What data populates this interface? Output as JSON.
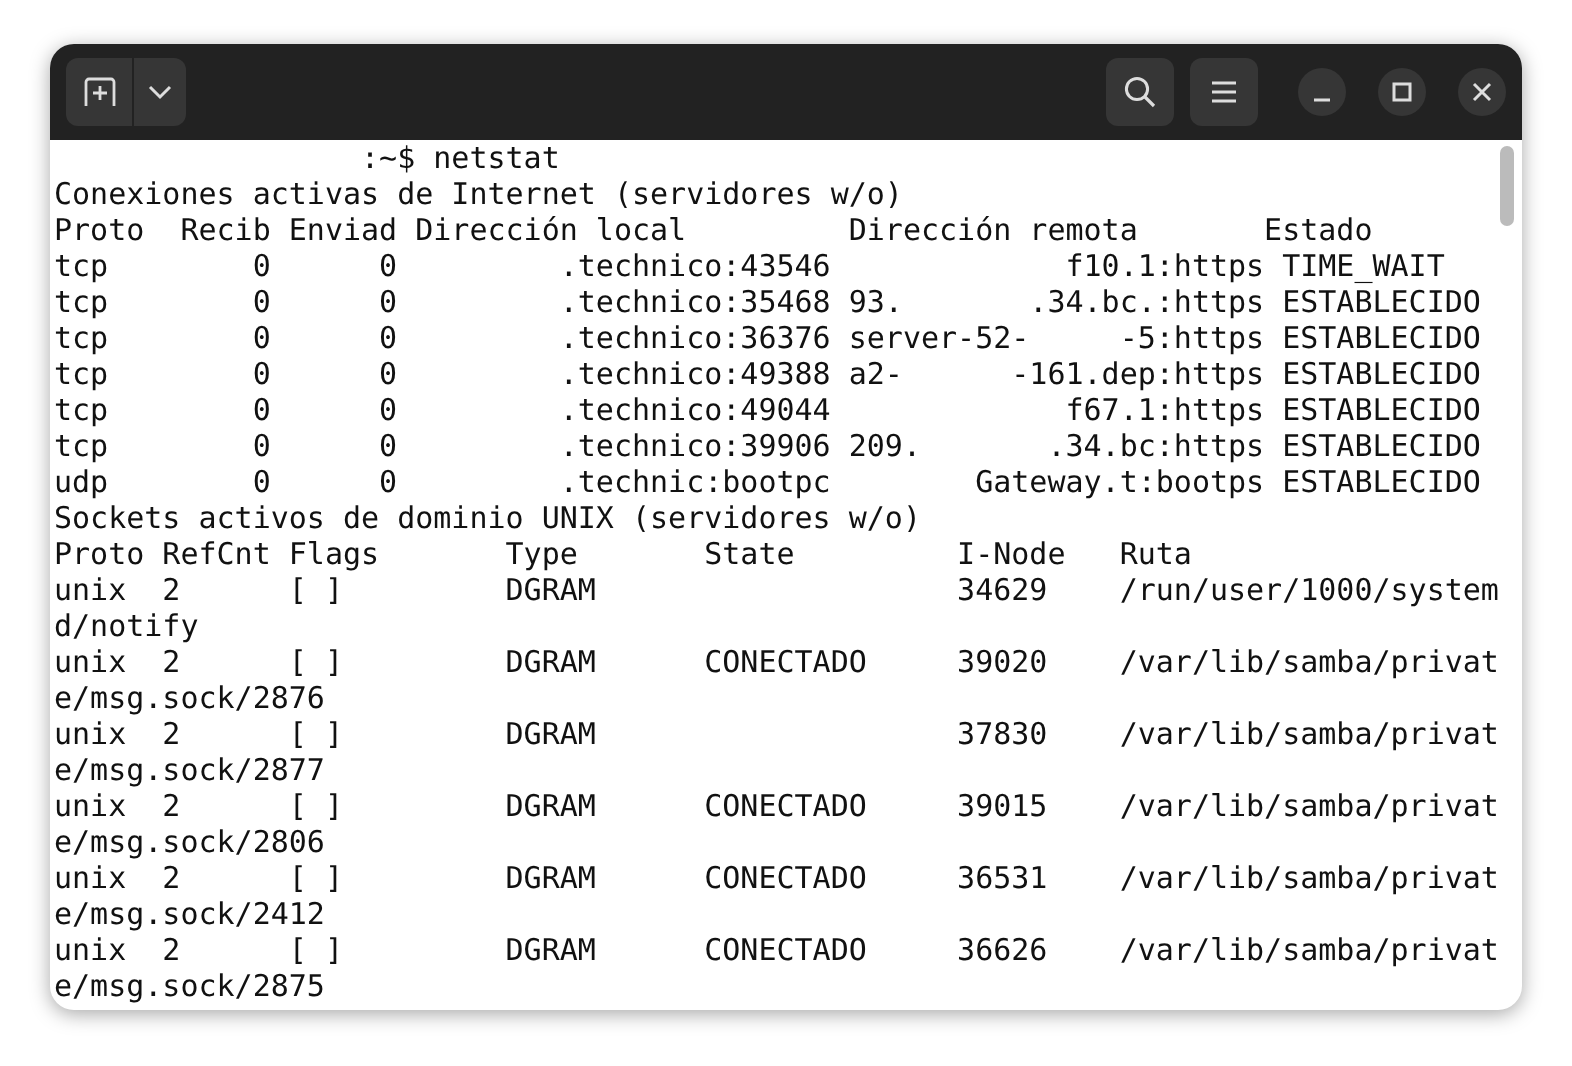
{
  "terminal": {
    "lines": [
      "                 :~$ netstat",
      "Conexiones activas de Internet (servidores w/o)",
      "Proto  Recib Enviad Dirección local         Dirección remota       Estado",
      "tcp        0      0         .technico:43546             f10.1:https TIME_WAIT",
      "tcp        0      0         .technico:35468 93.       .34.bc.:https ESTABLECIDO",
      "tcp        0      0         .technico:36376 server-52-     -5:https ESTABLECIDO",
      "tcp        0      0         .technico:49388 a2-      -161.dep:https ESTABLECIDO",
      "tcp        0      0         .technico:49044             f67.1:https ESTABLECIDO",
      "tcp        0      0         .technico:39906 209.       .34.bc:https ESTABLECIDO",
      "udp        0      0         .technic:bootpc        Gateway.t:bootps ESTABLECIDO",
      "Sockets activos de dominio UNIX (servidores w/o)",
      "Proto RefCnt Flags       Type       State         I-Node   Ruta",
      "unix  2      [ ]         DGRAM                    34629    /run/user/1000/system",
      "d/notify",
      "unix  2      [ ]         DGRAM      CONECTADO     39020    /var/lib/samba/privat",
      "e/msg.sock/2876",
      "unix  2      [ ]         DGRAM                    37830    /var/lib/samba/privat",
      "e/msg.sock/2877",
      "unix  2      [ ]         DGRAM      CONECTADO     39015    /var/lib/samba/privat",
      "e/msg.sock/2806",
      "unix  2      [ ]         DGRAM      CONECTADO     36531    /var/lib/samba/privat",
      "e/msg.sock/2412",
      "unix  2      [ ]         DGRAM      CONECTADO     36626    /var/lib/samba/privat",
      "e/msg.sock/2875"
    ]
  }
}
